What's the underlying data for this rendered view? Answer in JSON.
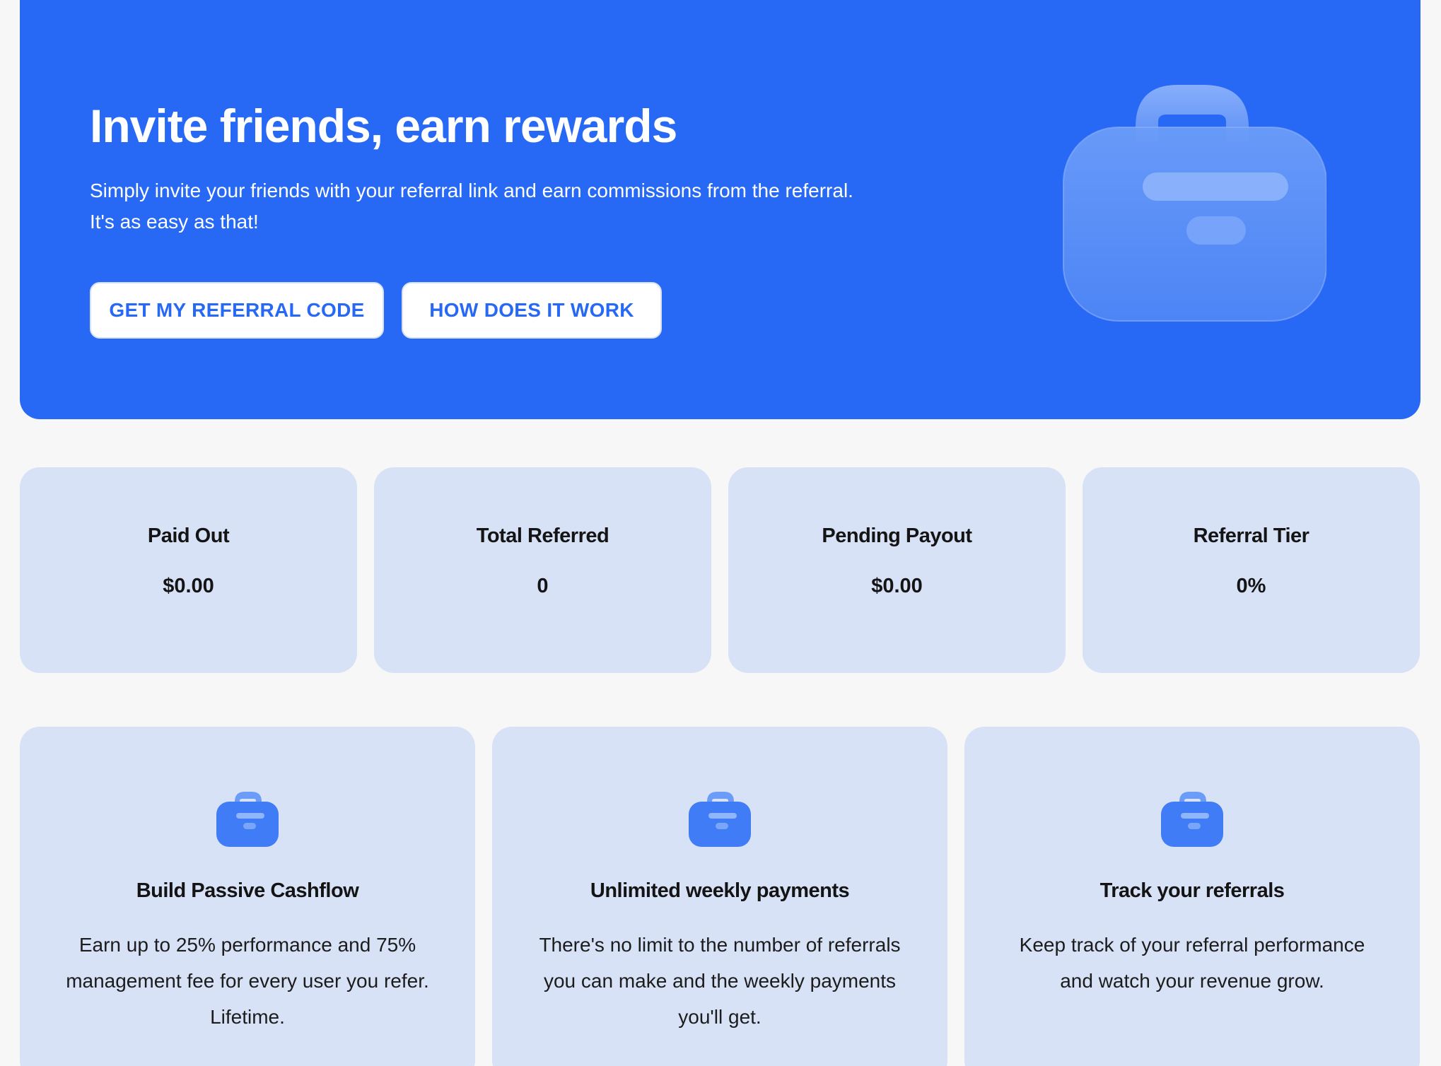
{
  "hero": {
    "title": "Invite friends, earn rewards",
    "subtitle_line1": "Simply invite your friends with your referral link and earn commissions from the referral.",
    "subtitle_line2": "It's as easy as that!",
    "primary_button": "GET MY REFERRAL CODE",
    "secondary_button": "HOW DOES IT WORK",
    "illustration_icon": "briefcase-icon",
    "background_color": "#2769f5"
  },
  "stats": [
    {
      "label": "Paid Out",
      "value": "$0.00"
    },
    {
      "label": "Total Referred",
      "value": "0"
    },
    {
      "label": "Pending Payout",
      "value": "$0.00"
    },
    {
      "label": "Referral Tier",
      "value": "0%"
    }
  ],
  "features": [
    {
      "icon": "briefcase-icon",
      "title": "Build Passive Cashflow",
      "desc_line1": "Earn up to 25% performance and 75%",
      "desc_line2": "management fee for every user you refer.",
      "desc_line3": "Lifetime."
    },
    {
      "icon": "briefcase-icon",
      "title": "Unlimited weekly payments",
      "desc_line1": "There's no limit to the number of referrals",
      "desc_line2": "you can make and the weekly payments",
      "desc_line3": "you'll get."
    },
    {
      "icon": "briefcase-icon",
      "title": "Track your referrals",
      "desc_line1": "Keep track of your referral performance",
      "desc_line2": "and watch your revenue grow.",
      "desc_line3": ""
    }
  ],
  "colors": {
    "accent": "#2769f5",
    "card_bg": "#d8e2f7",
    "page_bg": "#f7f7f7"
  }
}
